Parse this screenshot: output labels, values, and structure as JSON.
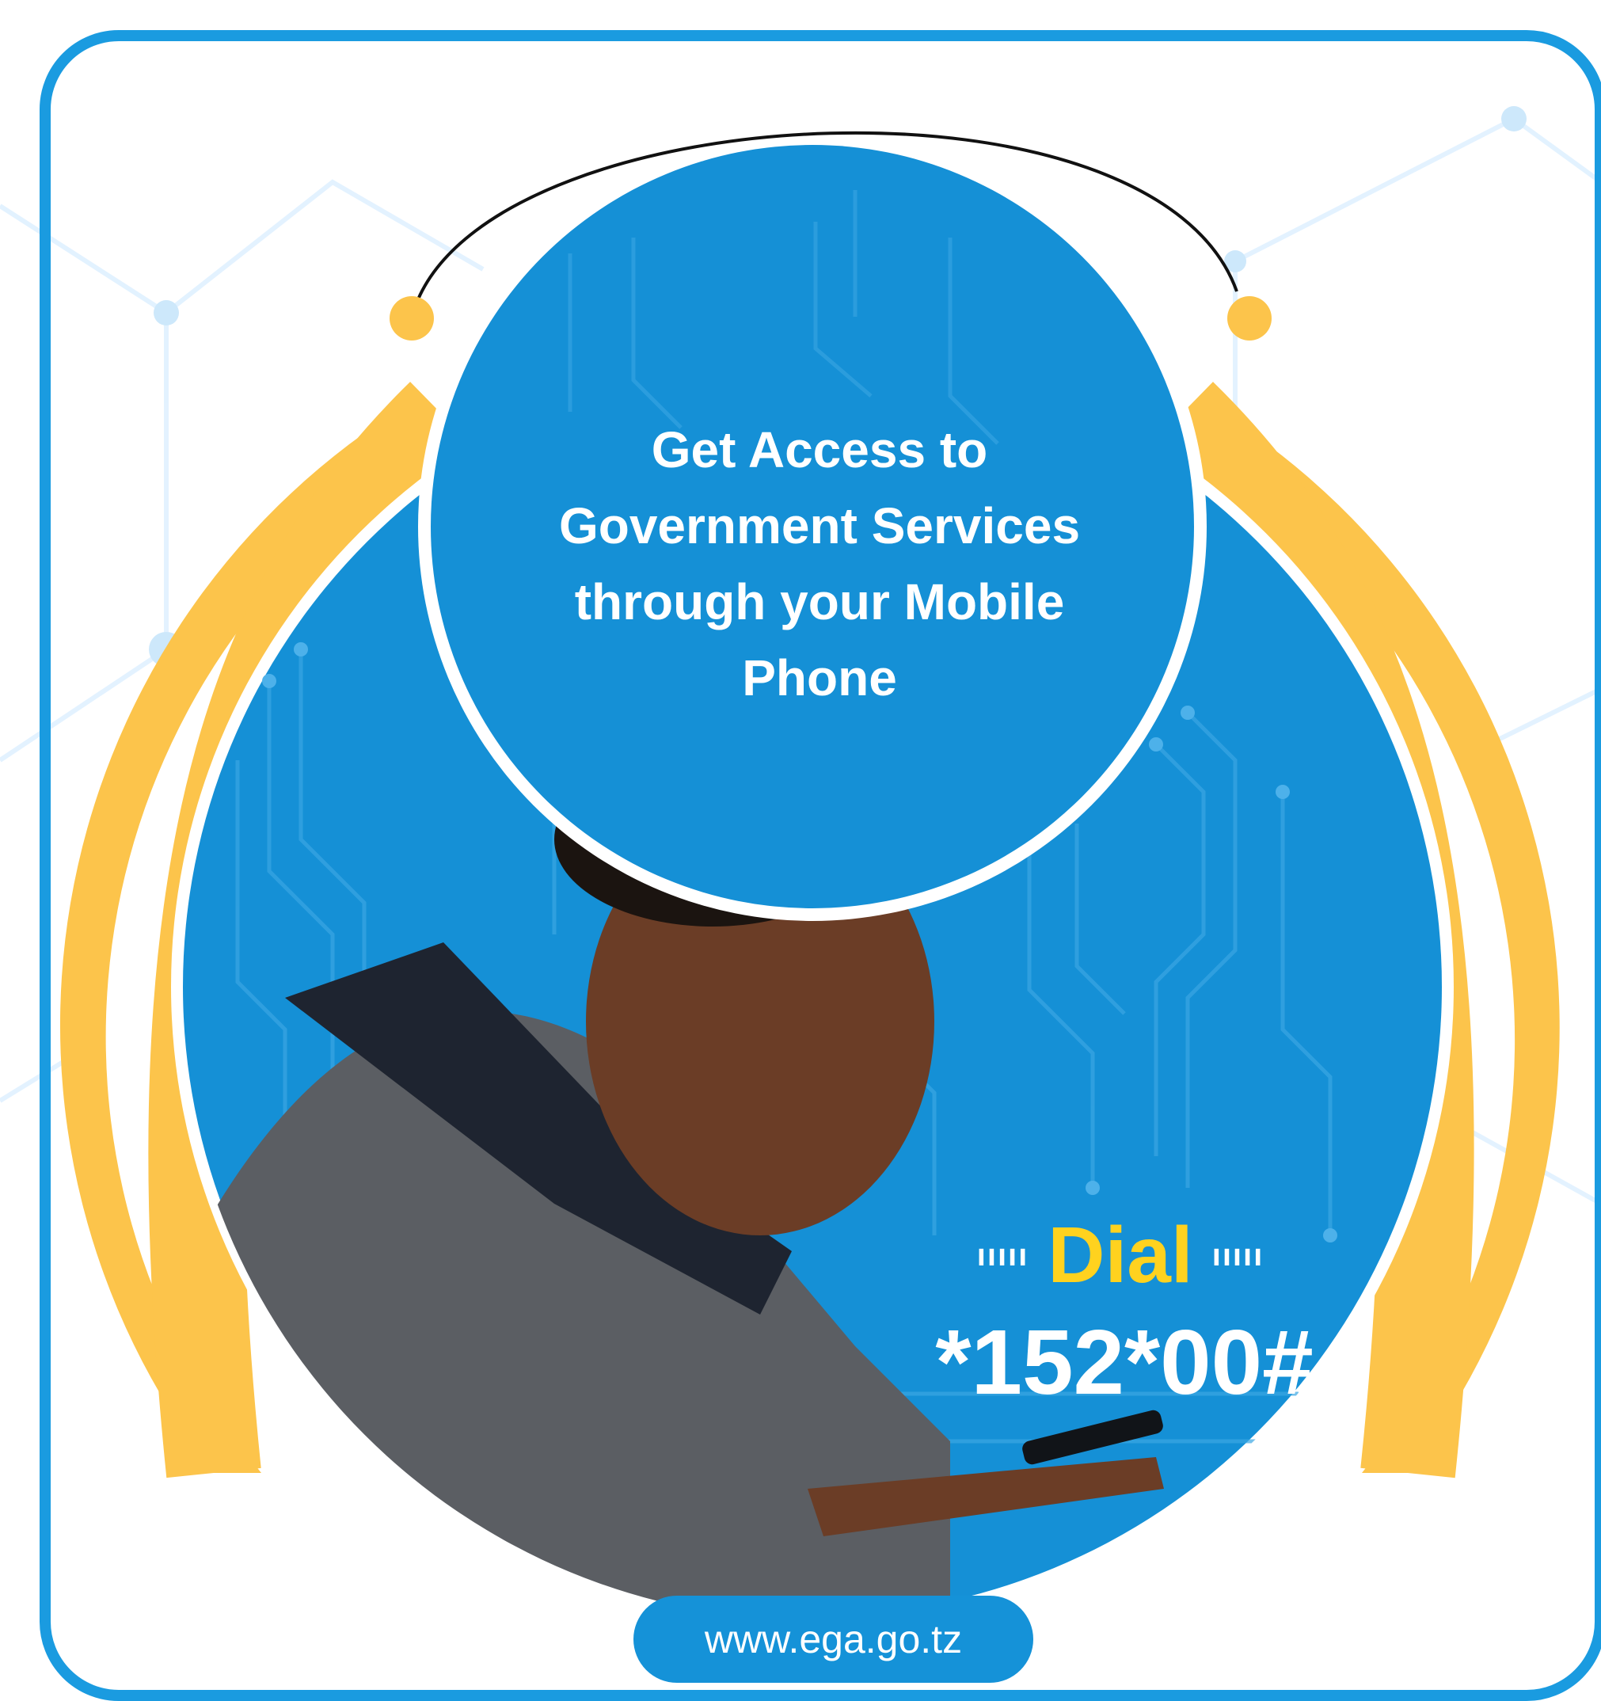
{
  "headline": {
    "line1": "Get Access to",
    "line2": "Government Services",
    "line3": "through your Mobile",
    "line4": "Phone"
  },
  "dial": {
    "prefix_dots": "ııııı",
    "label": "Dial",
    "suffix_dots": "ııııı",
    "code": "*152*00#"
  },
  "website": "www.ega.go.tz",
  "colors": {
    "frame_blue": "#1a9be0",
    "circle_blue": "#1590d6",
    "accent_yellow": "#fcc44b",
    "dial_yellow": "#ffd21f"
  }
}
